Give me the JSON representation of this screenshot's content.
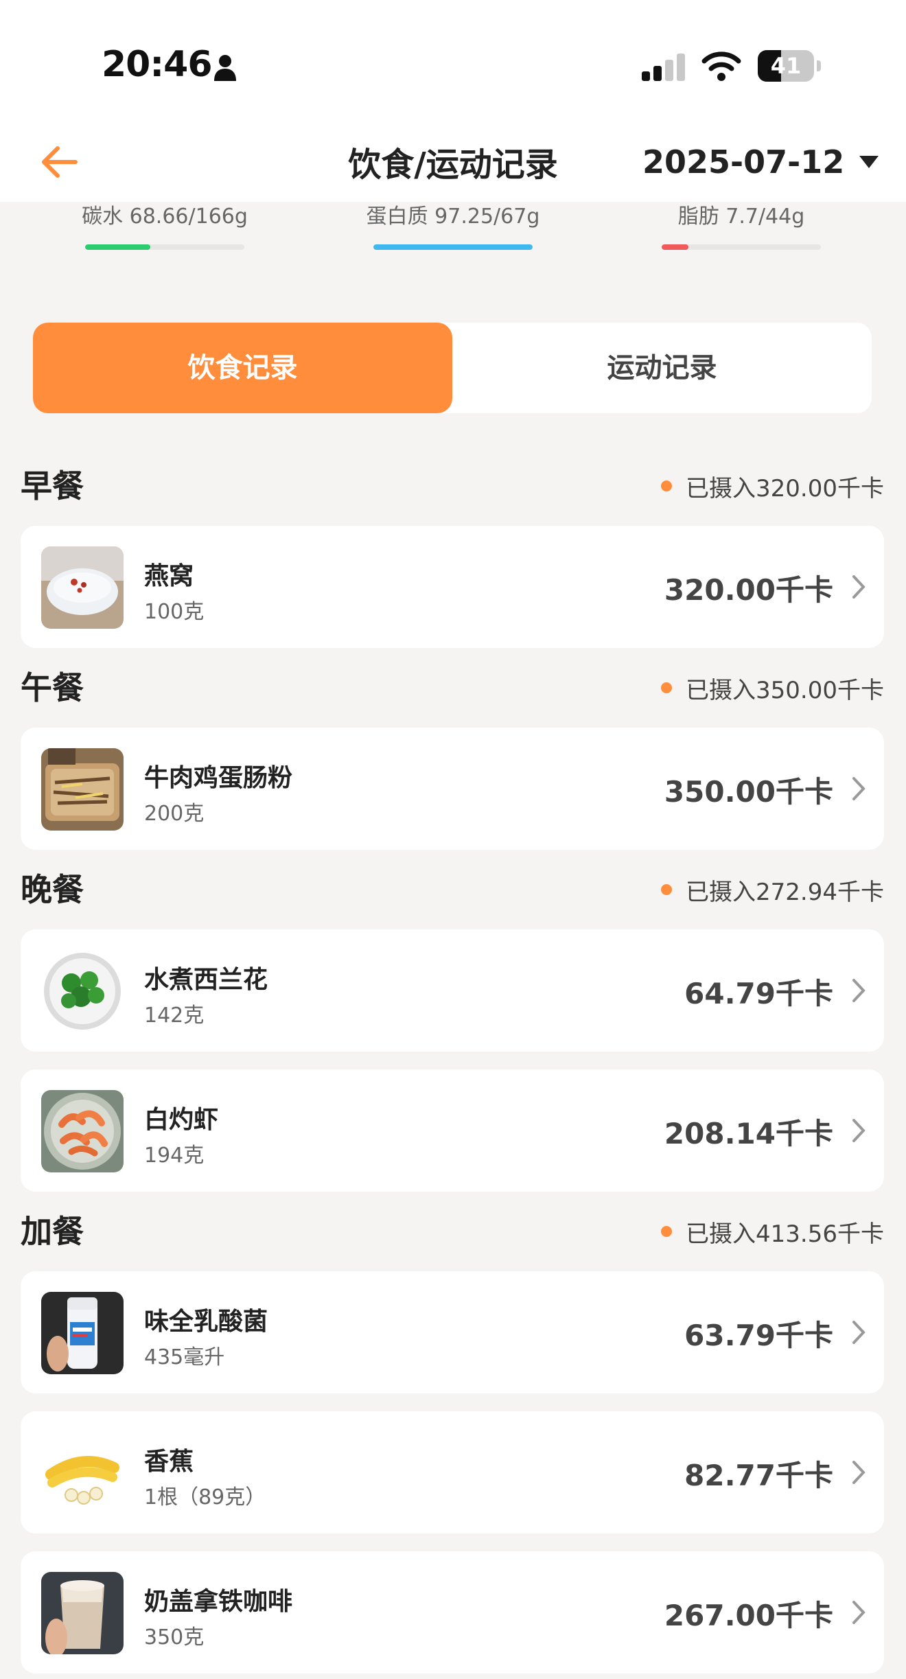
{
  "status_bar": {
    "time": "20:46",
    "battery_level": "41",
    "battery_fraction": 0.41,
    "icons": [
      "person-icon",
      "signal-icon",
      "wifi-icon",
      "battery-icon"
    ]
  },
  "header": {
    "title": "饮食/运动记录",
    "date": "2025-07-12",
    "icons": [
      "back-arrow-icon",
      "caret-down-icon"
    ]
  },
  "macros": [
    {
      "label": "碳水 68.66/166g",
      "progress": 0.41,
      "color": "#2ecc71"
    },
    {
      "label": "蛋白质 97.25/67g",
      "progress": 1.0,
      "color": "#3fb8f0"
    },
    {
      "label": "脂肪 7.7/44g",
      "progress": 0.17,
      "color": "#f05a5a"
    }
  ],
  "tabs": [
    {
      "label": "饮食记录",
      "active": true
    },
    {
      "label": "运动记录",
      "active": false
    }
  ],
  "accent_color": "#ff8d3b",
  "meals": [
    {
      "title": "早餐",
      "total": "已摄入320.00千卡",
      "items": [
        {
          "name": "燕窝",
          "qty": "100克",
          "kcal": "320.00千卡",
          "icon": "bird-nest-icon"
        }
      ]
    },
    {
      "title": "午餐",
      "total": "已摄入350.00千卡",
      "items": [
        {
          "name": "牛肉鸡蛋肠粉",
          "qty": "200克",
          "kcal": "350.00千卡",
          "icon": "rice-roll-icon"
        }
      ]
    },
    {
      "title": "晚餐",
      "total": "已摄入272.94千卡",
      "items": [
        {
          "name": "水煮西兰花",
          "qty": "142克",
          "kcal": "64.79千卡",
          "icon": "broccoli-icon"
        },
        {
          "name": "白灼虾",
          "qty": "194克",
          "kcal": "208.14千卡",
          "icon": "shrimp-icon"
        }
      ]
    },
    {
      "title": "加餐",
      "total": "已摄入413.56千卡",
      "items": [
        {
          "name": "味全乳酸菌",
          "qty": "435毫升",
          "kcal": "63.79千卡",
          "icon": "yogurt-drink-icon"
        },
        {
          "name": "香蕉",
          "qty": "1根（89克）",
          "kcal": "82.77千卡",
          "icon": "banana-icon"
        },
        {
          "name": "奶盖拿铁咖啡",
          "qty": "350克",
          "kcal": "267.00千卡",
          "icon": "latte-icon"
        }
      ]
    }
  ]
}
